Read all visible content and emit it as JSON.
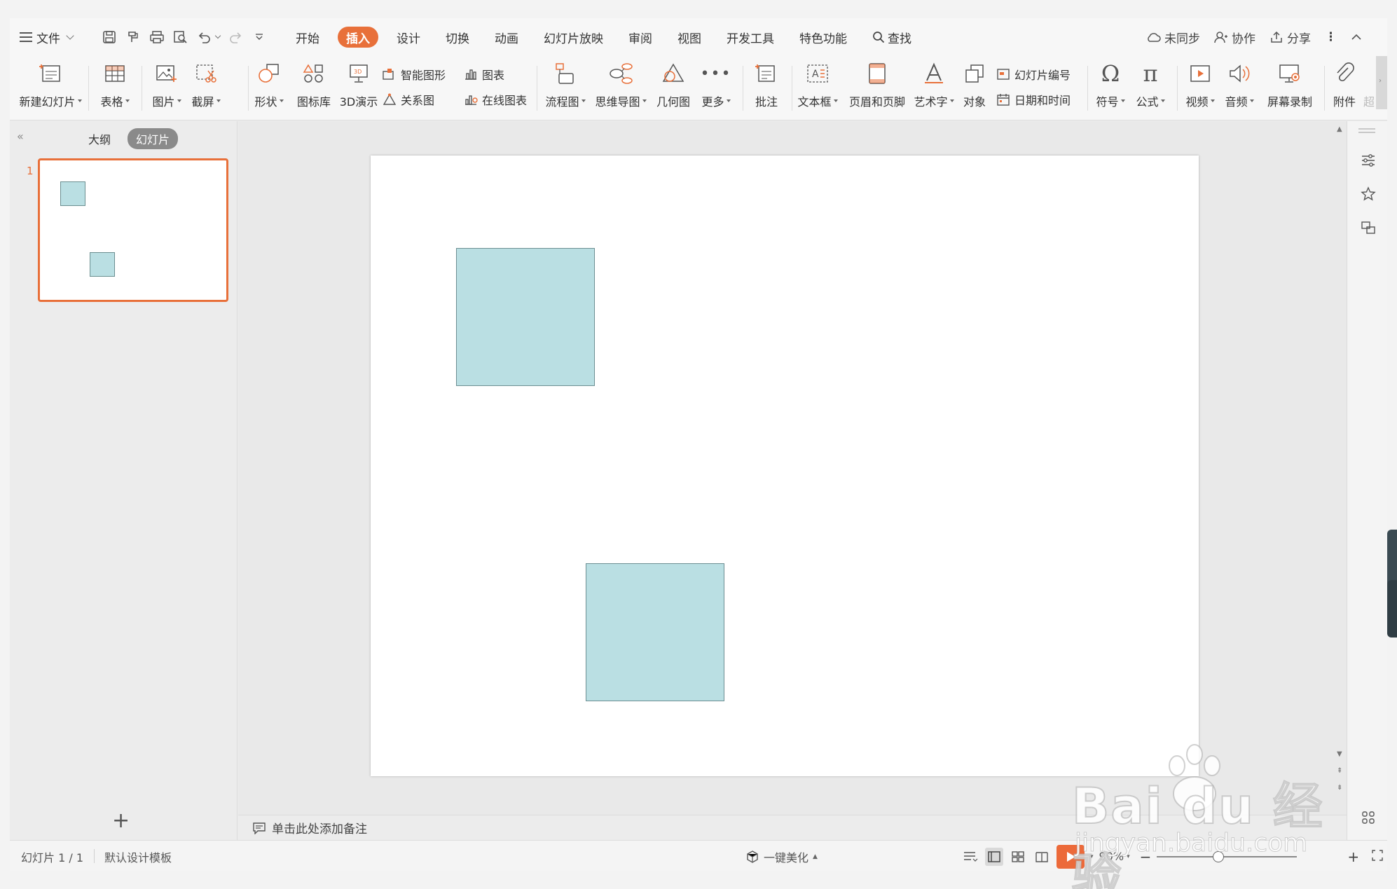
{
  "menu": {
    "file_label": "文件",
    "tabs": [
      "开始",
      "插入",
      "设计",
      "切换",
      "动画",
      "幻灯片放映",
      "审阅",
      "视图",
      "开发工具",
      "特色功能"
    ],
    "active_tab": "插入",
    "search_label": "查找",
    "sync_label": "未同步",
    "collab_label": "协作",
    "share_label": "分享"
  },
  "ribbon": {
    "new_slide": "新建幻灯片",
    "table": "表格",
    "picture": "图片",
    "screenshot": "截屏",
    "shapes": "形状",
    "icon_library": "图标库",
    "demo_3d": "3D演示",
    "smart_art": "智能图形",
    "chart": "图表",
    "relation": "关系图",
    "online_chart": "在线图表",
    "flowchart": "流程图",
    "mindmap": "思维导图",
    "geometry": "几何图",
    "more": "更多",
    "comment": "批注",
    "textbox": "文本框",
    "header_footer": "页眉和页脚",
    "wordart": "艺术字",
    "object": "对象",
    "slide_number": "幻灯片编号",
    "date_time": "日期和时间",
    "symbol": "符号",
    "formula": "公式",
    "video": "视频",
    "audio": "音频",
    "screen_record": "屏幕录制",
    "attachment": "附件",
    "hyperlink_partial": "超"
  },
  "left_panel": {
    "outline_tab": "大纲",
    "slides_tab": "幻灯片",
    "slide_number": "1",
    "add_slide_glyph": "+"
  },
  "notes": {
    "placeholder": "单击此处添加备注"
  },
  "status": {
    "slide_counter": "幻灯片 1 / 1",
    "template": "默认设计模板",
    "beautify": "一键美化",
    "zoom": "90%"
  },
  "watermark": {
    "brand": "Bai du 经验",
    "url": "jingyan.baidu.com"
  },
  "colors": {
    "accent": "#e8703a",
    "shape_fill": "#badfe3",
    "shape_border": "#6c8e92"
  }
}
